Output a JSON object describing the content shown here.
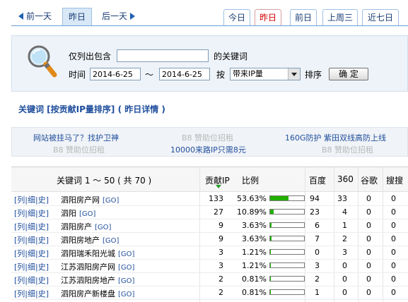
{
  "nav": {
    "prev_day": "前一天",
    "yesterday": "昨日",
    "next_day": "后一天",
    "tabs": [
      "今日",
      "昨日",
      "前日",
      "上周三",
      "近七日"
    ],
    "active_tab": 1
  },
  "search": {
    "only_list_label": "仅列出包含",
    "keyword_value": "",
    "keyword_suffix": "的关键词",
    "time_label": "时间",
    "date_from": "2014-6-25",
    "tilde": "～",
    "date_to": "2014-6-25",
    "by_label": "按",
    "sort_option": "带来IP量",
    "sort_label": "排序",
    "confirm_label": "确 定"
  },
  "heading": "关键词 [按贡献IP量排序] ( 昨日详情 )",
  "ads": {
    "row1": [
      "网站被挂马了？找护卫神",
      "B8 赞助位招租",
      "160G防护 紫田双线高防上线"
    ],
    "row2": [
      "B8 赞助位招租",
      "10000来路IP只需8元",
      "B8 赞助位招租"
    ]
  },
  "table": {
    "headers": {
      "keyword": "关键词 1 ～ 50 ( 共 70 )",
      "ip": "贡献IP",
      "ratio": "比例",
      "baidu": "百度",
      "s360": "360",
      "google": "谷歌",
      "sogou": "搜搜"
    },
    "link_labels": [
      "列",
      "细",
      "史"
    ],
    "go_label": "[GO]",
    "rows": [
      {
        "kw": "泗阳房产网",
        "ip": "133",
        "ratio": "53.63%",
        "pct": 53.63,
        "baidu": "94",
        "s360": "33",
        "google": "0",
        "sogou": "0"
      },
      {
        "kw": "泗阳",
        "ip": "27",
        "ratio": "10.89%",
        "pct": 10.89,
        "baidu": "23",
        "s360": "4",
        "google": "0",
        "sogou": "0"
      },
      {
        "kw": "泗阳房产",
        "ip": "9",
        "ratio": "3.63%",
        "pct": 3.63,
        "baidu": "6",
        "s360": "1",
        "google": "0",
        "sogou": "0"
      },
      {
        "kw": "泗阳房地产",
        "ip": "9",
        "ratio": "3.63%",
        "pct": 3.63,
        "baidu": "7",
        "s360": "2",
        "google": "0",
        "sogou": "0"
      },
      {
        "kw": "泗阳瑞禾阳光城",
        "ip": "3",
        "ratio": "1.21%",
        "pct": 1.21,
        "baidu": "0",
        "s360": "3",
        "google": "0",
        "sogou": "0"
      },
      {
        "kw": "江苏泗阳房产网",
        "ip": "3",
        "ratio": "1.21%",
        "pct": 1.21,
        "baidu": "3",
        "s360": "0",
        "google": "0",
        "sogou": "0"
      },
      {
        "kw": "江苏泗阳房地产",
        "ip": "2",
        "ratio": "0.81%",
        "pct": 0.81,
        "baidu": "2",
        "s360": "0",
        "google": "0",
        "sogou": "0"
      },
      {
        "kw": "泗阳房产新楼盘",
        "ip": "2",
        "ratio": "0.81%",
        "pct": 0.81,
        "baidu": "1",
        "s360": "0",
        "google": "0",
        "sogou": "0"
      }
    ]
  },
  "colors": {
    "link": "#1f4e9c",
    "active_tab_text": "#d40000",
    "bar_fill": "#22b000",
    "panel_bg": "#eef3f9"
  }
}
